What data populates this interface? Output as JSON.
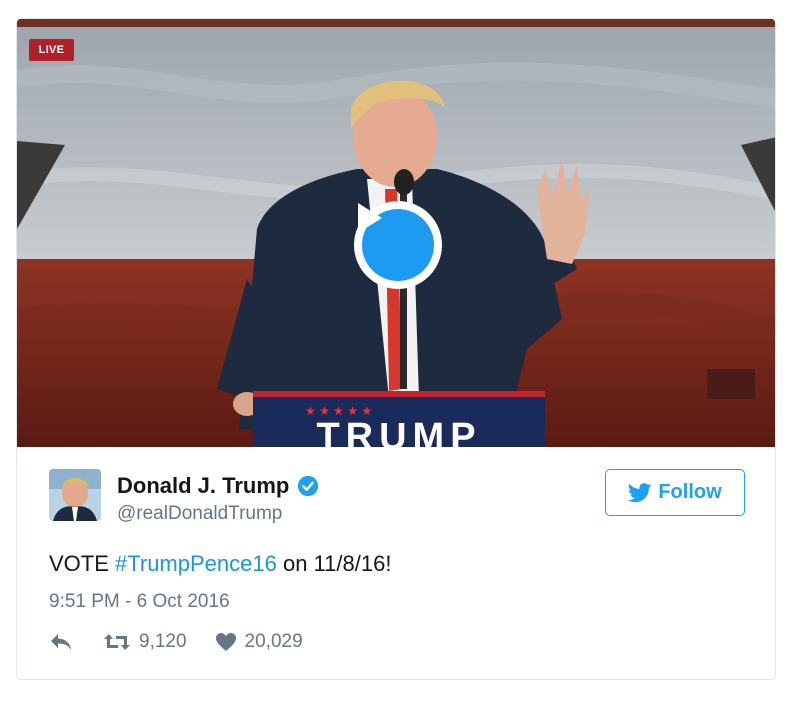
{
  "media": {
    "live_badge": "LIVE",
    "podium_sign": "TRUMP",
    "play_icon": "play-icon"
  },
  "tweet": {
    "display_name": "Donald J. Trump",
    "handle": "@realDonaldTrump",
    "follow_label": "Follow",
    "text_before": "VOTE ",
    "hashtag": "#TrumpPence16",
    "text_after": " on 11/8/16!",
    "timestamp": "9:51 PM - 6 Oct 2016",
    "retweets": "9,120",
    "likes": "20,029"
  },
  "colors": {
    "accent": "#1da1f2",
    "hashtag": "#1b95e0",
    "live_red": "#b0202b",
    "verified": "#1da1f2"
  },
  "icons": [
    "reply-icon",
    "retweet-icon",
    "heart-icon",
    "verified-badge-icon",
    "twitter-bird-icon"
  ]
}
